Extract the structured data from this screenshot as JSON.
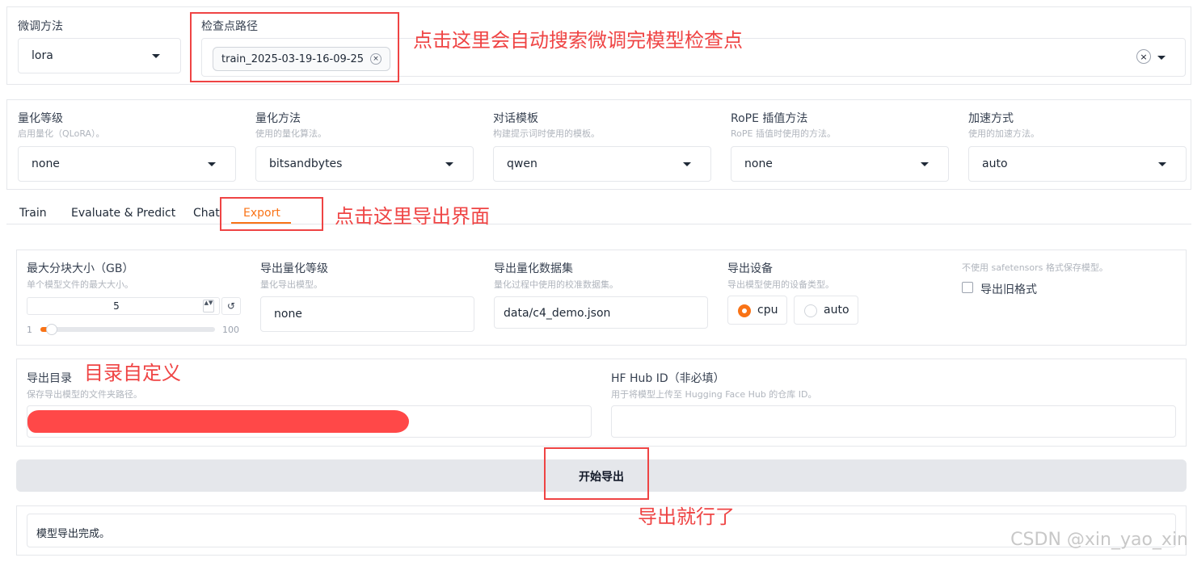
{
  "top_row": {
    "finetune_method": {
      "label": "微调方法",
      "value": "lora"
    },
    "checkpoint": {
      "label": "检查点路径",
      "chip": "train_2025-03-19-16-09-25",
      "chip_remove": "×",
      "clear": "×"
    }
  },
  "settings_row": [
    {
      "label": "量化等级",
      "desc": "启用量化（QLoRA）。",
      "value": "none"
    },
    {
      "label": "量化方法",
      "desc": "使用的量化算法。",
      "value": "bitsandbytes"
    },
    {
      "label": "对话模板",
      "desc": "构建提示词时使用的模板。",
      "value": "qwen"
    },
    {
      "label": "RoPE 插值方法",
      "desc": "RoPE 插值时使用的方法。",
      "value": "none"
    },
    {
      "label": "加速方式",
      "desc": "使用的加速方法。",
      "value": "auto"
    }
  ],
  "tabs": [
    {
      "label": "Train",
      "active": false
    },
    {
      "label": "Evaluate & Predict",
      "active": false
    },
    {
      "label": "Chat",
      "active": false
    },
    {
      "label": "Export",
      "active": true
    }
  ],
  "export": {
    "max_shard": {
      "label": "最大分块大小（GB）",
      "desc": "单个模型文件的最大大小。",
      "value": "5",
      "min": "1",
      "max": "100",
      "spin": "▲▼",
      "reset": "↺",
      "slider_fraction": 0.04
    },
    "quant_bit": {
      "label": "导出量化等级",
      "desc": "量化导出模型。",
      "value": "none"
    },
    "quant_dataset": {
      "label": "导出量化数据集",
      "desc": "量化过程中使用的校准数据集。",
      "value": "data/c4_demo.json"
    },
    "device": {
      "label": "导出设备",
      "desc": "导出模型使用的设备类型。",
      "options": [
        {
          "label": "cpu",
          "selected": true
        },
        {
          "label": "auto",
          "selected": false
        }
      ]
    },
    "legacy": {
      "desc": "不使用 safetensors 格式保存模型。",
      "label": "导出旧格式",
      "checked": false
    },
    "export_dir": {
      "label": "导出目录",
      "desc": "保存导出模型的文件夹路径。"
    },
    "hub_id": {
      "label": "HF Hub ID（非必填）",
      "desc": "用于将模型上传至 Hugging Face Hub 的仓库 ID。",
      "value": ""
    },
    "start_button": "开始导出",
    "output": "模型导出完成。"
  },
  "annotations": {
    "checkpoint_note": "点击这里会自动搜索微调完模型检查点",
    "export_tab_note": "点击这里导出界面",
    "dir_note": "目录自定义",
    "done_note": "导出就行了",
    "color": "#ef4444"
  },
  "watermark": "CSDN @xin_yao_xin",
  "accent_color": "#f97316"
}
